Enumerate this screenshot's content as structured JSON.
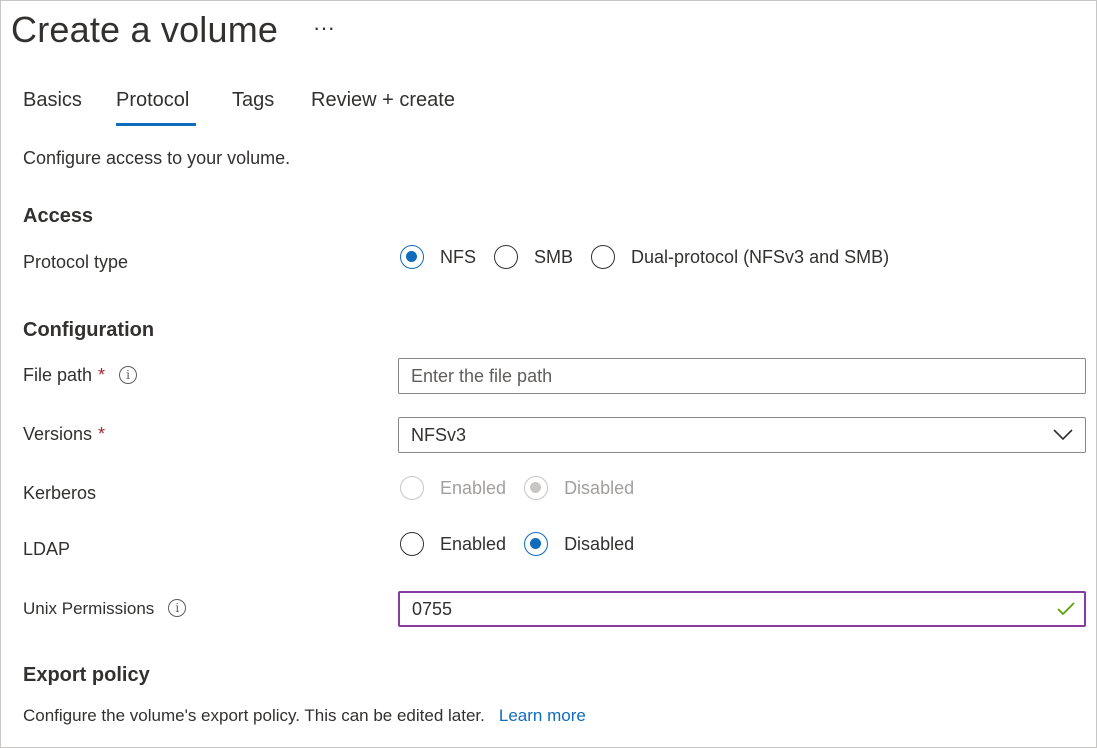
{
  "page": {
    "title": "Create a volume",
    "more_label": "···"
  },
  "tabs": [
    {
      "label": "Basics",
      "active": false
    },
    {
      "label": "Protocol",
      "active": true
    },
    {
      "label": "Tags",
      "active": false
    },
    {
      "label": "Review + create",
      "active": false
    }
  ],
  "intro": "Configure access to your volume.",
  "access": {
    "heading": "Access",
    "protocol_type": {
      "label": "Protocol type",
      "options": [
        "NFS",
        "SMB",
        "Dual-protocol (NFSv3 and SMB)"
      ],
      "selected": "NFS"
    }
  },
  "configuration": {
    "heading": "Configuration",
    "file_path": {
      "label": "File path",
      "required_mark": "*",
      "info_icon": "info-icon",
      "placeholder": "Enter the file path",
      "value": ""
    },
    "versions": {
      "label": "Versions",
      "required_mark": "*",
      "value": "NFSv3"
    },
    "kerberos": {
      "label": "Kerberos",
      "enabled_label": "Enabled",
      "disabled_label": "Disabled",
      "selected": "Disabled",
      "disabled_state": true
    },
    "ldap": {
      "label": "LDAP",
      "enabled_label": "Enabled",
      "disabled_label": "Disabled",
      "selected": "Disabled"
    },
    "unix_permissions": {
      "label": "Unix Permissions",
      "info_icon": "info-icon",
      "value": "0755",
      "valid": true
    }
  },
  "export_policy": {
    "heading": "Export policy",
    "description": "Configure the volume's export policy. This can be edited later.",
    "link": "Learn more"
  },
  "colors": {
    "accent": "#0f6cbd",
    "required": "#a4262c",
    "focus_border": "#8a3ba3",
    "valid_check": "#57a300"
  }
}
